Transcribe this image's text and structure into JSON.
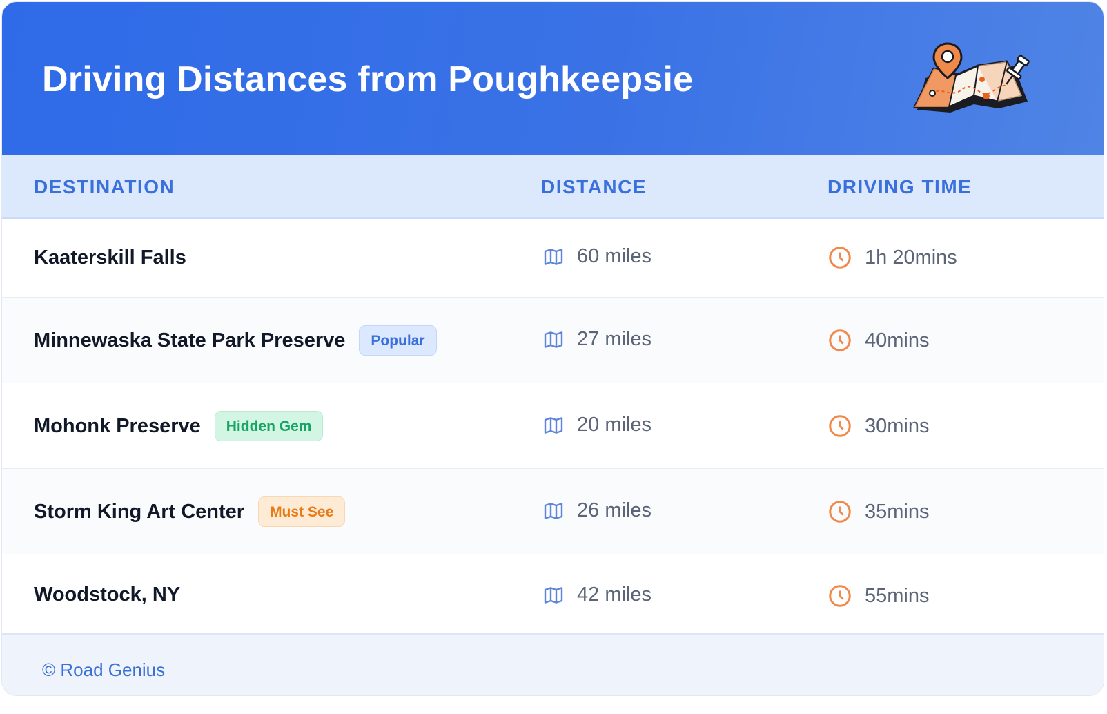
{
  "header": {
    "title": "Driving Distances from Poughkeepsie",
    "illustration": "map-with-pins-icon"
  },
  "table": {
    "columns": [
      "DESTINATION",
      "DISTANCE",
      "DRIVING TIME"
    ],
    "rows": [
      {
        "destination": "Kaaterskill Falls",
        "badge": "",
        "distance": "60 miles",
        "time": "1h 20mins"
      },
      {
        "destination": "Minnewaska State Park Preserve",
        "badge": "Popular",
        "distance": "27 miles",
        "time": "40mins"
      },
      {
        "destination": "Mohonk Preserve",
        "badge": "Hidden Gem",
        "distance": "20 miles",
        "time": "30mins"
      },
      {
        "destination": "Storm King Art Center",
        "badge": "Must See",
        "distance": "26 miles",
        "time": "35mins"
      },
      {
        "destination": "Woodstock, NY",
        "badge": "",
        "distance": "42 miles",
        "time": "55mins"
      }
    ]
  },
  "footer": {
    "text": "© Road Genius"
  },
  "colors": {
    "header_blue": "#2f6be8",
    "accent_blue": "#3a70dc",
    "badge_green": "#16a364",
    "badge_orange": "#ea7a16",
    "clock_orange": "#f0894a"
  },
  "icons": {
    "distance": "map-icon",
    "time": "clock-icon"
  }
}
